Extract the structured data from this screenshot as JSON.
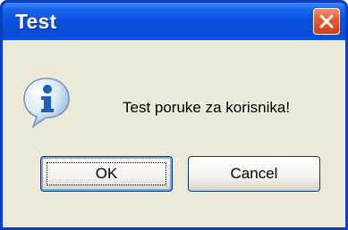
{
  "dialog": {
    "title": "Test",
    "message": "Test poruke za korisnika!",
    "icon": "information-icon",
    "buttons": {
      "ok_label": "OK",
      "cancel_label": "Cancel"
    }
  },
  "colors": {
    "titlebar_blue": "#0a52e0",
    "client_background": "#ece9d8",
    "close_button_red": "#e25a2c",
    "button_border": "#003c74"
  }
}
